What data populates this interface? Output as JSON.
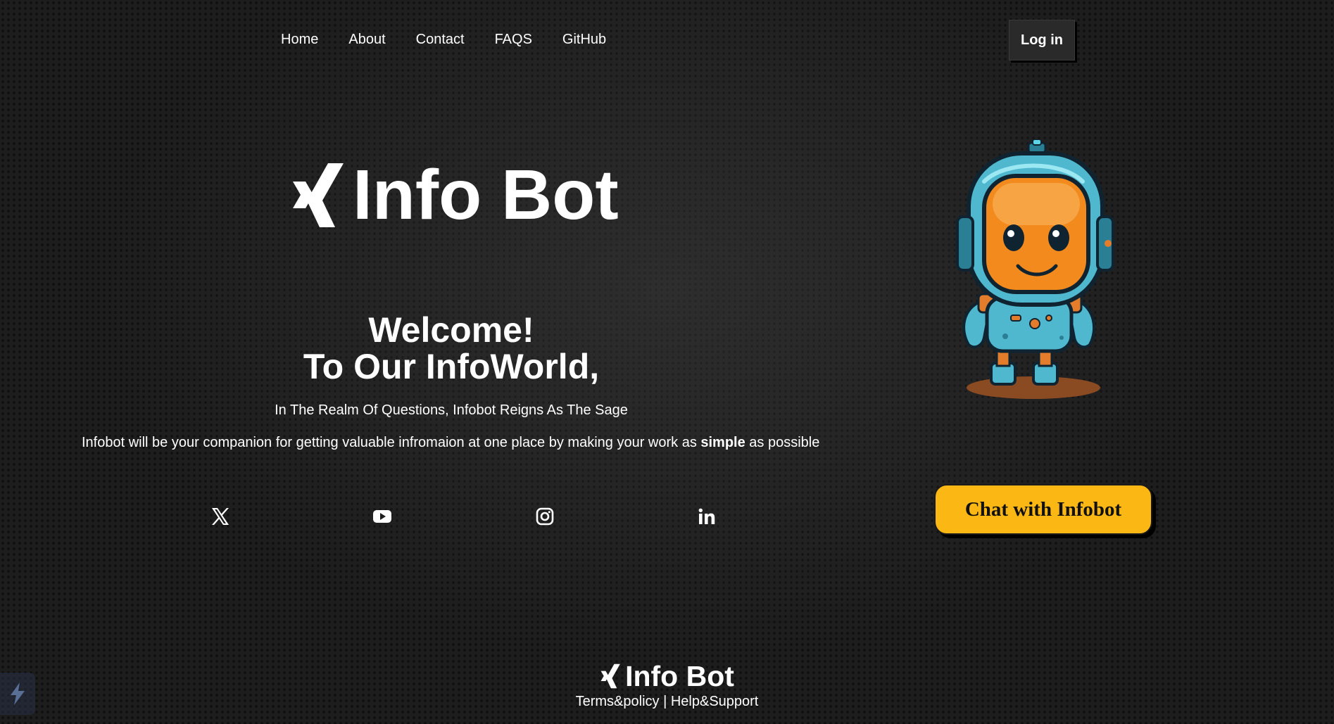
{
  "nav": {
    "items": [
      {
        "label": "Home"
      },
      {
        "label": "About"
      },
      {
        "label": "Contact"
      },
      {
        "label": "FAQS"
      },
      {
        "label": "GitHub"
      }
    ],
    "login_label": "Log in"
  },
  "hero": {
    "logo_icon": "xing-logo-icon",
    "title": "Info Bot",
    "welcome_line1": "Welcome!",
    "welcome_line2": "To Our InfoWorld,",
    "tagline": "In The Realm Of Questions, Infobot Reigns As The Sage",
    "description_before": "Infobot will be your companion for getting valuable infromaion at one place by making your work as ",
    "description_bold": "simple",
    "description_after": " as possible"
  },
  "social": [
    {
      "icon": "x-twitter-icon"
    },
    {
      "icon": "youtube-icon"
    },
    {
      "icon": "instagram-icon"
    },
    {
      "icon": "linkedin-icon"
    }
  ],
  "cta": {
    "label": "Chat with Infobot",
    "color": "#fbb713"
  },
  "footer": {
    "title": "Info Bot",
    "terms": "Terms&policy",
    "separator": " | ",
    "help": "Help&Support"
  },
  "colors": {
    "background": "#1d1d1d",
    "accent": "#fbb713",
    "text": "#ffffff"
  }
}
